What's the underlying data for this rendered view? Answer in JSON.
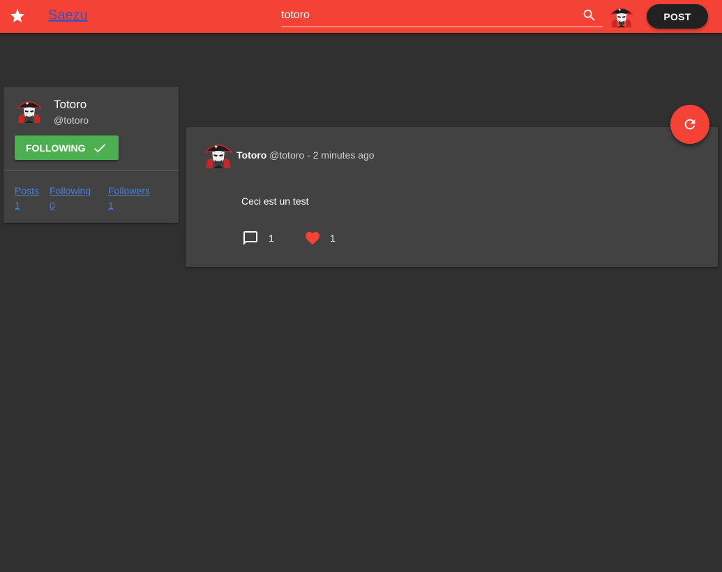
{
  "colors": {
    "topbar": "#f44336",
    "background": "#303030",
    "card": "#424242",
    "brand_link": "#3f51b5",
    "following_button": "#4caf50",
    "stat_link": "#4a7fd6",
    "heart": "#f44336"
  },
  "header": {
    "star_icon": "star-icon",
    "brand": "Saezu",
    "search_value": "totoro",
    "search_icon": "search-icon",
    "post_label": "POST"
  },
  "profile": {
    "name": "Totoro",
    "handle": "@totoro",
    "follow_label": "FOLLOWING",
    "stats": [
      {
        "label": "Posts",
        "value": "1"
      },
      {
        "label": "Following",
        "value": "0"
      },
      {
        "label": "Followers",
        "value": "1"
      }
    ]
  },
  "feed": {
    "refresh_icon": "refresh-icon",
    "posts": [
      {
        "author": "Totoro",
        "handle": "@totoro",
        "time": "- 2 minutes ago",
        "text": "Ceci est un test",
        "comments": "1",
        "likes": "1"
      }
    ]
  }
}
